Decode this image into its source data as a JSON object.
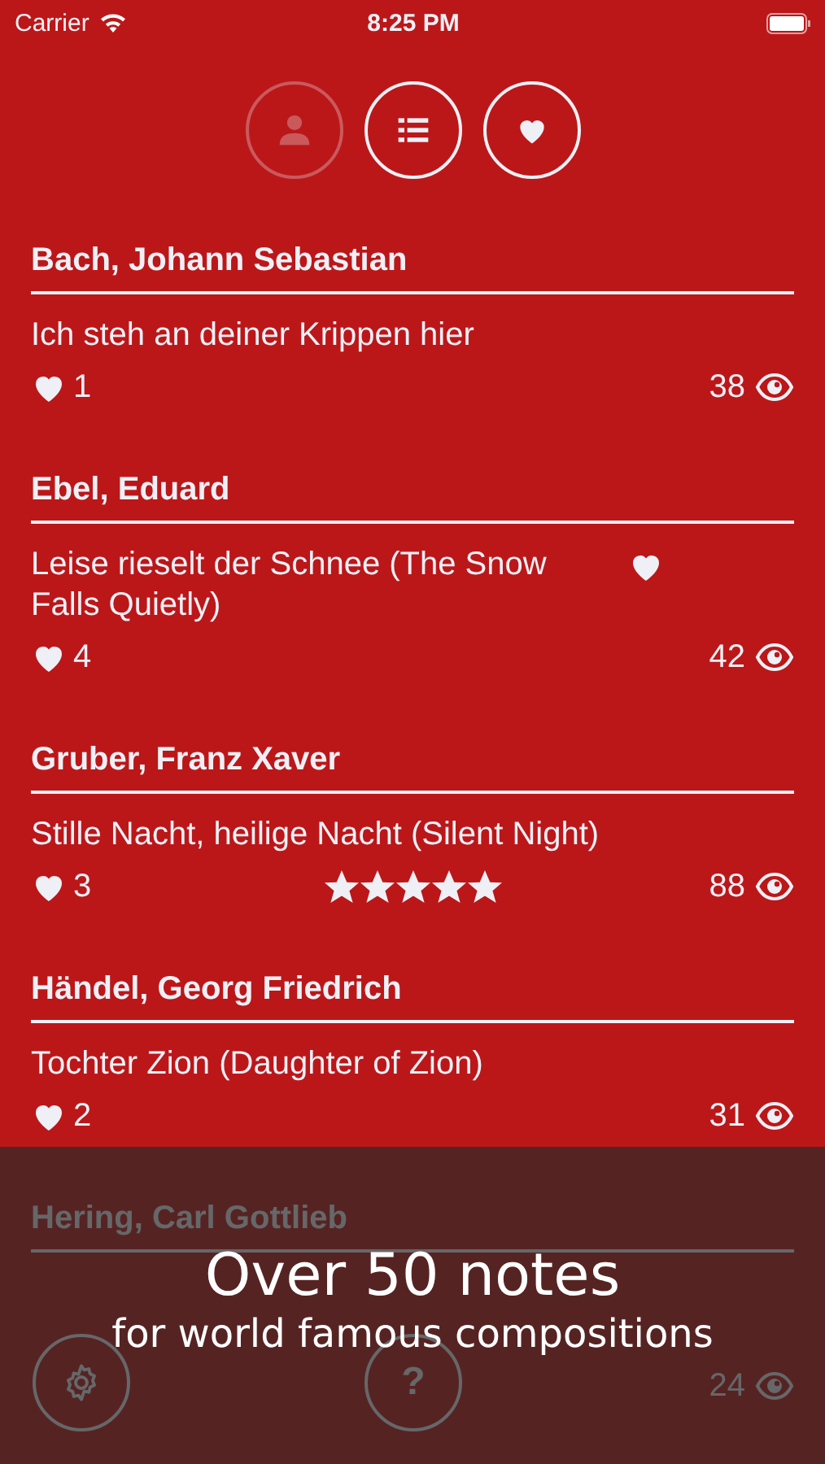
{
  "status_bar": {
    "carrier": "Carrier",
    "time": "8:25 PM"
  },
  "view_buttons": [
    {
      "kind": "person",
      "disabled": true
    },
    {
      "kind": "list",
      "disabled": false
    },
    {
      "kind": "heart",
      "disabled": false
    }
  ],
  "entries": [
    {
      "composer": "Bach, Johann Sebastian",
      "title": "Ich steh an deiner Krippen hier",
      "favorite": false,
      "likes": "1",
      "views": "38"
    },
    {
      "composer": "Ebel, Eduard",
      "title": "Leise rieselt der Schnee (The Snow Falls Quietly)",
      "favorite": true,
      "likes": "4",
      "views": "42"
    },
    {
      "composer": "Gruber, Franz Xaver",
      "title": "Stille Nacht, heilige Nacht (Silent Night)",
      "favorite": false,
      "likes": "3",
      "stars": 5,
      "views": "88"
    },
    {
      "composer": "Händel, Georg Friedrich",
      "title": "Tochter Zion (Daughter of Zion)",
      "favorite": false,
      "likes": "2",
      "views": "31"
    },
    {
      "composer": "Hering, Carl Gottlieb",
      "favorite": false,
      "views": "24"
    }
  ],
  "floating_buttons": [
    {
      "kind": "settings"
    },
    {
      "kind": "help",
      "label": "?"
    }
  ],
  "promo": {
    "headline": "Over 50 notes",
    "subline": "for world famous compositions"
  }
}
